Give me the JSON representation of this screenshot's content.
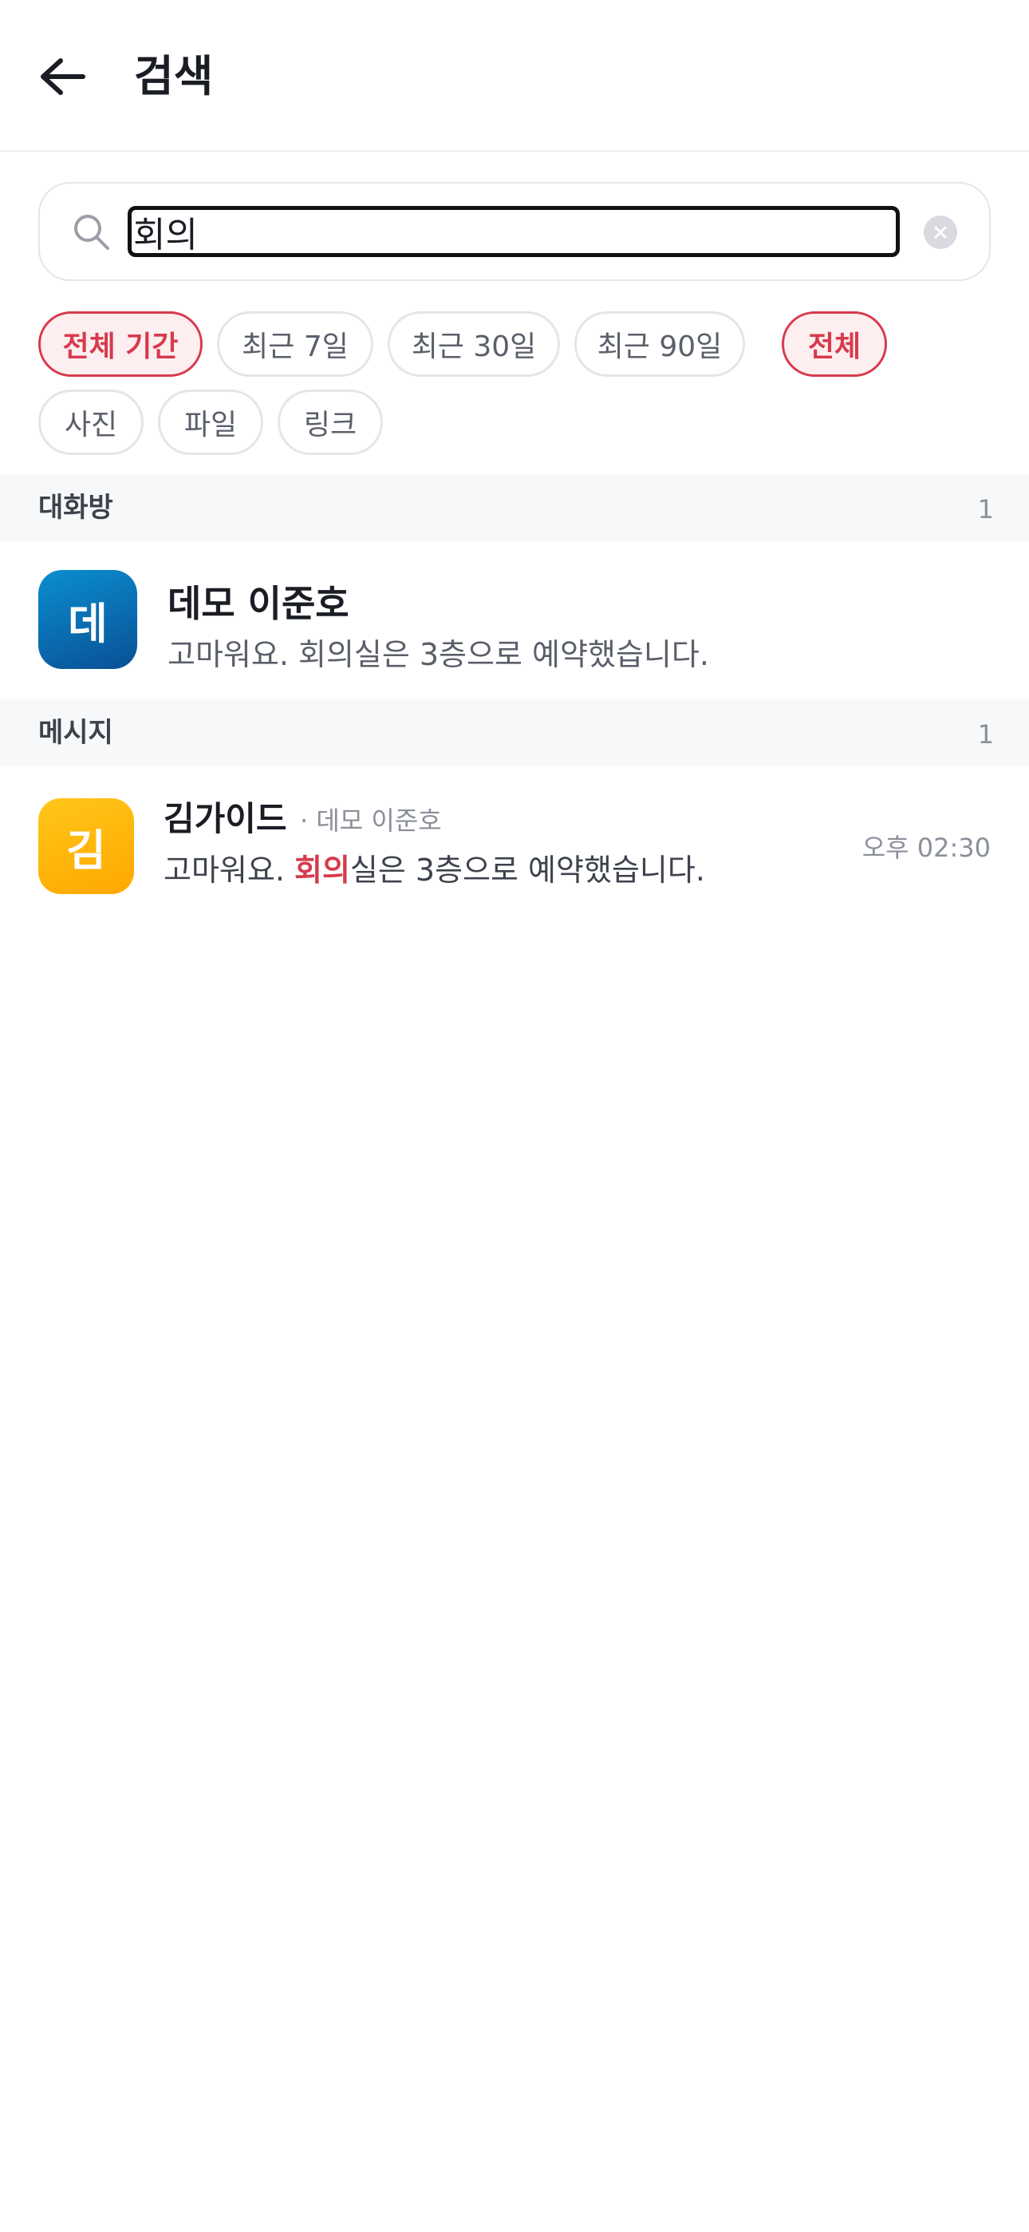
{
  "header": {
    "title": "검색"
  },
  "search": {
    "query": "회의",
    "placeholder": ""
  },
  "period_filters": [
    {
      "label": "전체 기간",
      "active": true
    },
    {
      "label": "최근 7일",
      "active": false
    },
    {
      "label": "최근 30일",
      "active": false
    },
    {
      "label": "최근 90일",
      "active": false
    }
  ],
  "type_filters": [
    {
      "label": "전체",
      "active": true
    },
    {
      "label": "사진",
      "active": false
    },
    {
      "label": "파일",
      "active": false
    },
    {
      "label": "링크",
      "active": false
    }
  ],
  "rooms_section": {
    "title": "대화방",
    "count": "1",
    "items": [
      {
        "avatar_letter": "데",
        "name": "데모 이준호",
        "preview": "고마워요. 회의실은 3층으로 예약했습니다."
      }
    ]
  },
  "messages_section": {
    "title": "메시지",
    "count": "1",
    "items": [
      {
        "avatar_letter": "김",
        "sender": "김가이드",
        "room": "· 데모 이준호",
        "text_before": "고마워요. ",
        "text_highlight": "회의",
        "text_after": "실은 3층으로 예약했습니다.",
        "time": "오후 02:30"
      }
    ]
  },
  "colors": {
    "accent": "#d63b4c",
    "avatar_blue_start": "#0a8fd0",
    "avatar_blue_end": "#0a4f95",
    "avatar_yellow_start": "#ffc61a",
    "avatar_yellow_end": "#ffa800"
  }
}
